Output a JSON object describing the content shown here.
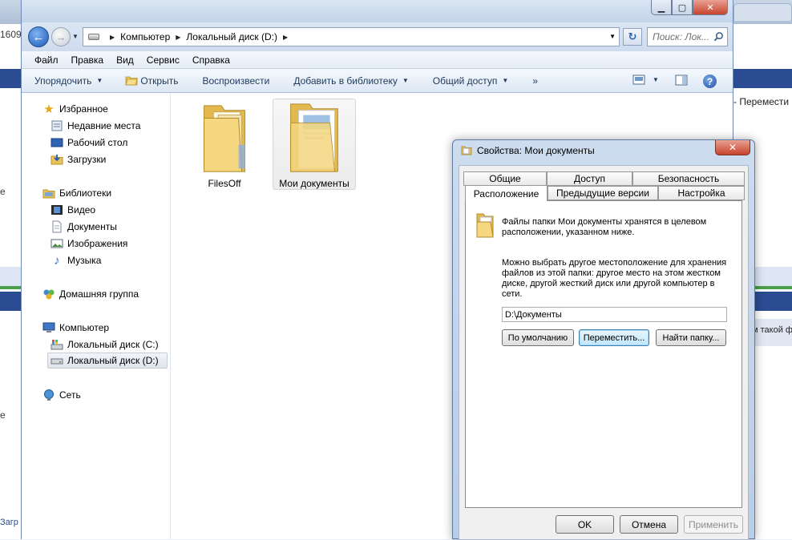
{
  "background": {
    "left_number": "1609",
    "left_glyph_a": "e",
    "left_glyph_b": "e",
    "left_bottom": "Загр",
    "right_text_1": "- Перемести",
    "right_text_2": "м такой ф"
  },
  "address_bar": {
    "crumbs": [
      "Компьютер",
      "Локальный диск (D:)"
    ],
    "search_placeholder": "Поиск: Лок..."
  },
  "menubar": [
    "Файл",
    "Правка",
    "Вид",
    "Сервис",
    "Справка"
  ],
  "toolbar": {
    "organize": "Упорядочить",
    "open": "Открыть",
    "play": "Воспроизвести",
    "add_library": "Добавить в библиотеку",
    "share": "Общий доступ",
    "more": "»"
  },
  "nav": {
    "favorites": "Избранное",
    "recent": "Недавние места",
    "desktop": "Рабочий стол",
    "downloads": "Загрузки",
    "libraries": "Библиотеки",
    "video": "Видео",
    "documents": "Документы",
    "images": "Изображения",
    "music": "Музыка",
    "homegroup": "Домашняя группа",
    "computer": "Компьютер",
    "drive_c": "Локальный диск (C:)",
    "drive_d": "Локальный диск (D:)",
    "network": "Сеть"
  },
  "content": {
    "folders": [
      "FilesOff",
      "Мои документы"
    ]
  },
  "dialog": {
    "title": "Свойства: Мои документы",
    "tabs_row1": [
      "Общие",
      "Доступ",
      "Безопасность"
    ],
    "tabs_row2": [
      "Расположение",
      "Предыдущие версии",
      "Настройка"
    ],
    "desc_line1": "Файлы папки Мои документы хранятся в целевом",
    "desc_line2": "расположении, указанном ниже.",
    "info_line1": "Можно выбрать другое местоположение для хранения",
    "info_line2": "файлов из этой папки: другое место на этом жестком",
    "info_line3": "диске, другой жесткий диск или другой компьютер в",
    "info_line4": "сети.",
    "path": "D:\\Документы",
    "btn_default": "По умолчанию",
    "btn_move": "Переместить...",
    "btn_find": "Найти папку...",
    "ok": "OK",
    "cancel": "Отмена",
    "apply": "Применить"
  },
  "colors": {
    "accent": "#2b4c93",
    "close": "#c7442c",
    "folder": "#f2d27a"
  }
}
